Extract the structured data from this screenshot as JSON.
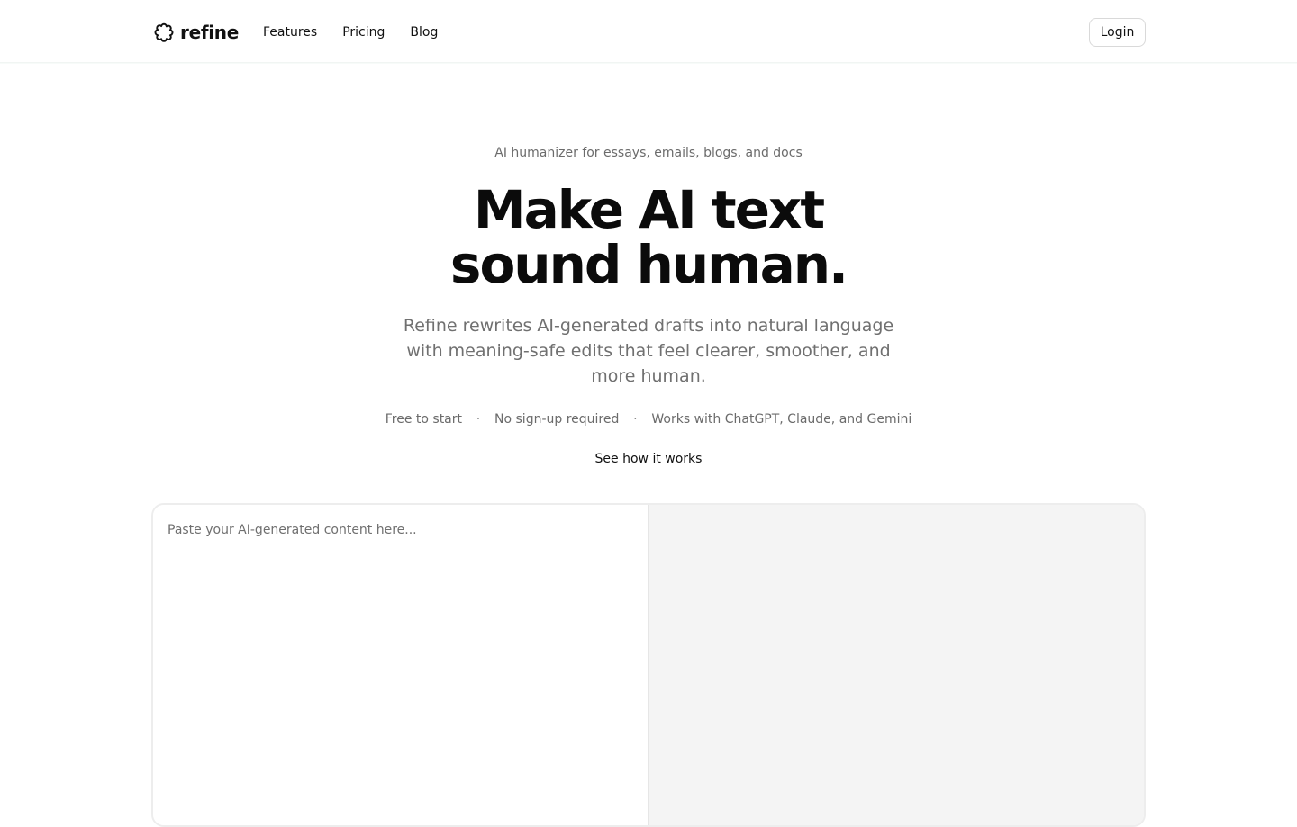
{
  "header": {
    "brand_name": "refine",
    "logo_icon": "flower-icon",
    "nav": [
      "Features",
      "Pricing",
      "Blog"
    ],
    "login_label": "Login"
  },
  "hero": {
    "eyebrow": "AI humanizer for essays, emails, blogs, and docs",
    "headline_line1": "Make AI text",
    "headline_line2": "sound human.",
    "subhead": "Refine rewrites AI-generated drafts into natural language with meaning-safe edits that feel clearer, smoother, and more human.",
    "perks": [
      "Free to start",
      "No sign-up required",
      "Works with ChatGPT, Claude, and Gemini"
    ],
    "separator": "·",
    "how_link": "See how it works"
  },
  "editor": {
    "input_placeholder": "Paste your AI-generated content here...",
    "input_value": ""
  },
  "colors": {
    "text_primary": "#111111",
    "text_muted": "#6b6b6b",
    "output_bg": "#f4f4f4",
    "border": "#ededed"
  }
}
